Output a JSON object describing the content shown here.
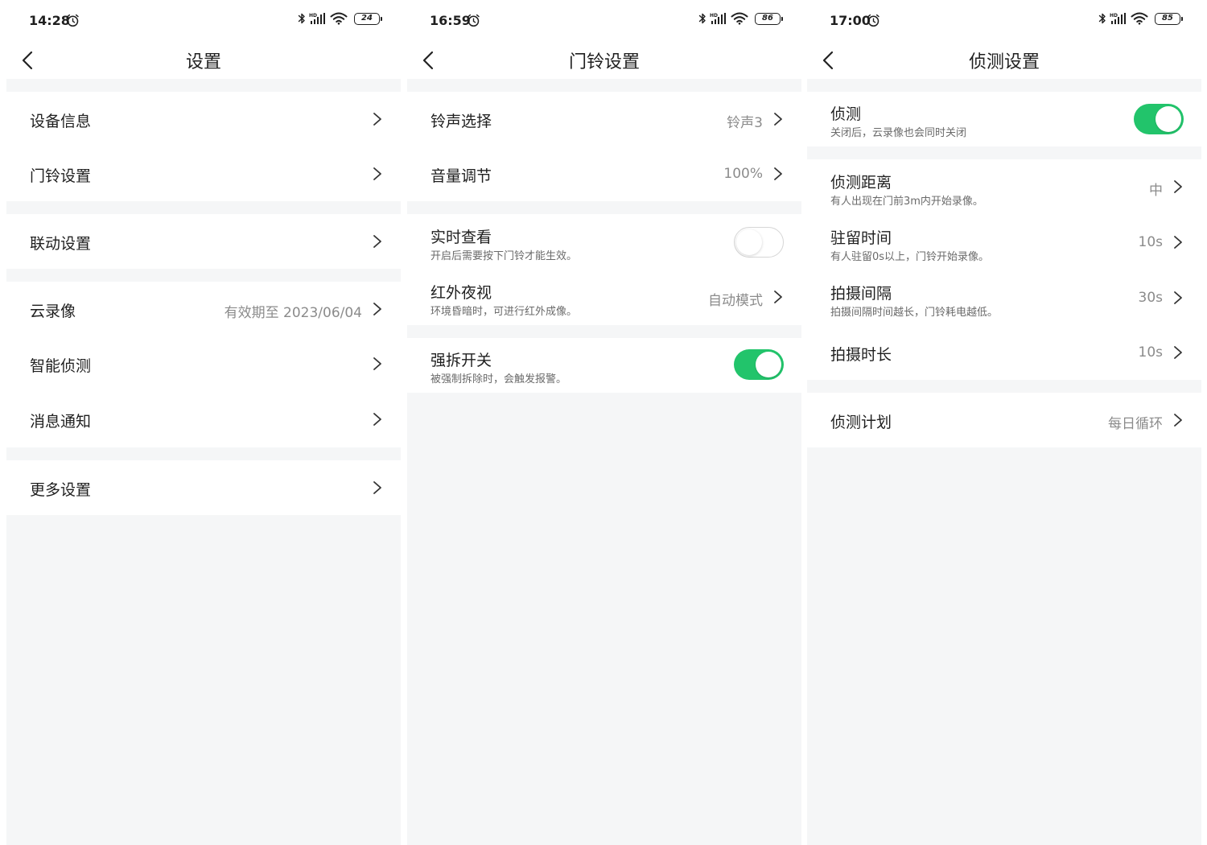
{
  "screens": [
    {
      "status": {
        "time": "14:28",
        "battery": "24"
      },
      "title": "设置",
      "rows": [
        {
          "title": "设备信息"
        },
        {
          "title": "门铃设置"
        },
        {
          "title": "联动设置"
        },
        {
          "title": "云录像",
          "value": "有效期至 2023/06/04"
        },
        {
          "title": "智能侦测"
        },
        {
          "title": "消息通知"
        },
        {
          "title": "更多设置"
        }
      ]
    },
    {
      "status": {
        "time": "16:59",
        "battery": "86"
      },
      "title": "门铃设置",
      "rows": [
        {
          "title": "铃声选择",
          "value": "铃声3"
        },
        {
          "title": "音量调节",
          "value": "100%"
        },
        {
          "title": "实时查看",
          "subtitle": "开启后需要按下门铃才能生效。",
          "toggle": false
        },
        {
          "title": "红外夜视",
          "subtitle": "环境昏暗时，可进行红外成像。",
          "value": "自动模式"
        },
        {
          "title": "强拆开关",
          "subtitle": "被强制拆除时，会触发报警。",
          "toggle": true
        }
      ]
    },
    {
      "status": {
        "time": "17:00",
        "battery": "85"
      },
      "title": "侦测设置",
      "rows": [
        {
          "title": "侦测",
          "subtitle": "关闭后，云录像也会同时关闭",
          "toggle": true
        },
        {
          "title": "侦测距离",
          "subtitle": "有人出现在门前3m内开始录像。",
          "value": "中"
        },
        {
          "title": "驻留时间",
          "subtitle": "有人驻留0s以上，门铃开始录像。",
          "value": "10s"
        },
        {
          "title": "拍摄间隔",
          "subtitle": "拍摄间隔时间越长，门铃耗电越低。",
          "value": "30s"
        },
        {
          "title": "拍摄时长",
          "value": "10s"
        },
        {
          "title": "侦测计划",
          "value": "每日循环"
        }
      ]
    }
  ],
  "icons": {
    "status": [
      "alarm-icon",
      "bluetooth-icon",
      "signal-icon",
      "wifi-icon",
      "battery-icon"
    ],
    "nav": "back-arrow-icon",
    "row": "chevron-right-icon"
  },
  "colors": {
    "toggle_on": "#22c46b",
    "background": "#f5f6f7",
    "card": "#ffffff",
    "secondary_text": "#8b8b8b"
  }
}
